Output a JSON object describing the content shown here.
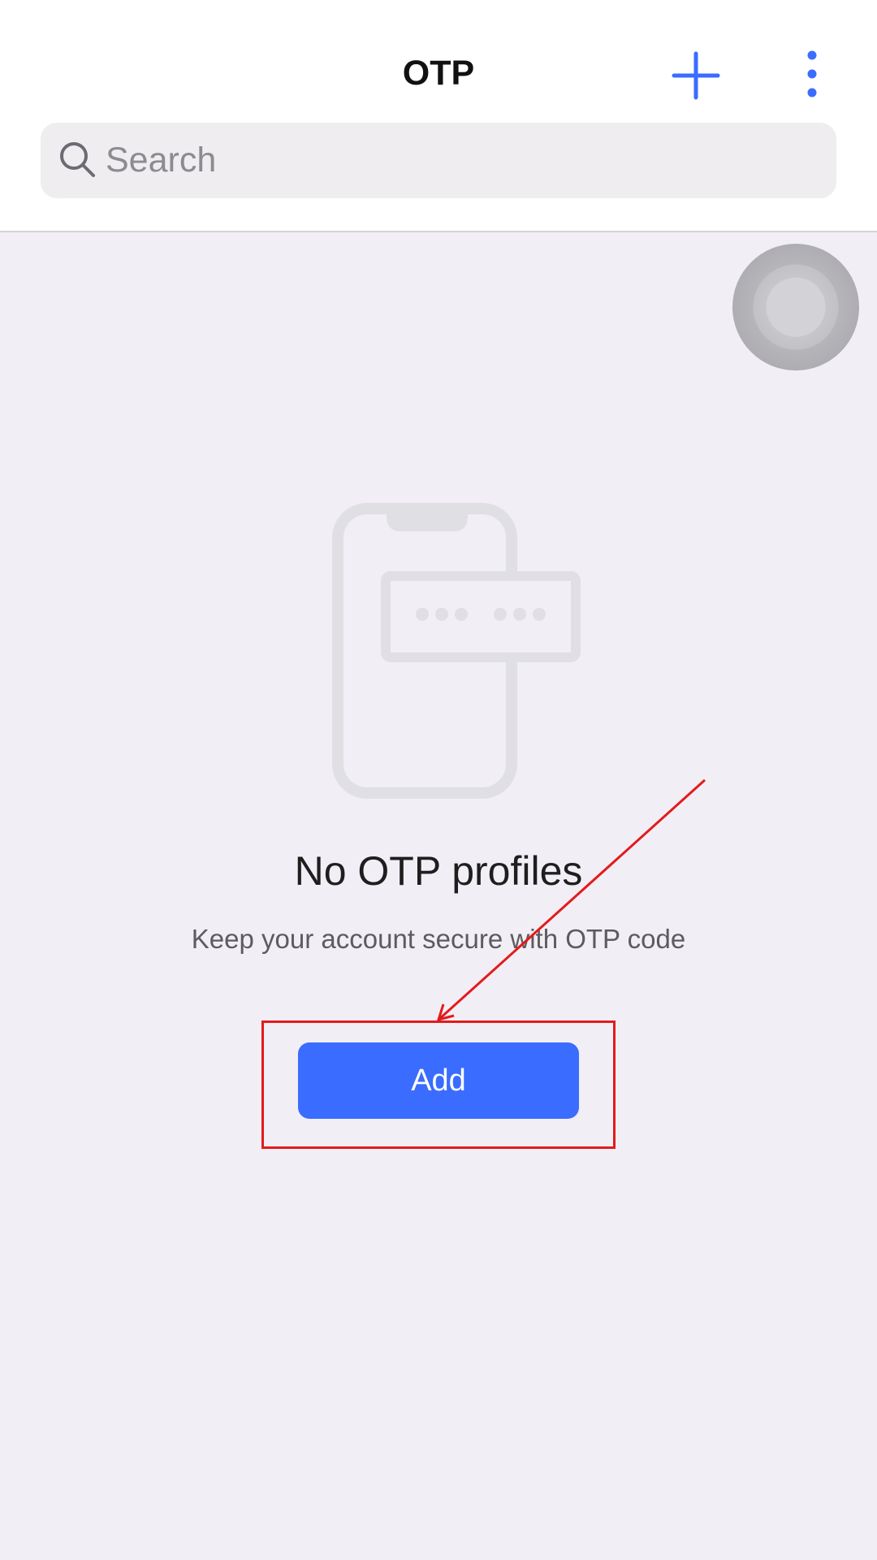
{
  "header": {
    "title": "OTP",
    "add_icon": "plus-icon",
    "more_icon": "vertical-ellipsis-icon"
  },
  "search": {
    "placeholder": "Search",
    "value": "",
    "icon": "search-icon"
  },
  "empty_state": {
    "illustration": "phone-otp-illustration",
    "title": "No OTP profiles",
    "subtitle": "Keep your account secure with OTP code",
    "add_button_label": "Add"
  },
  "colors": {
    "accent": "#3a6cff",
    "background": "#f1eff5",
    "header_background": "#ffffff",
    "annotation": "#e21b1b"
  }
}
